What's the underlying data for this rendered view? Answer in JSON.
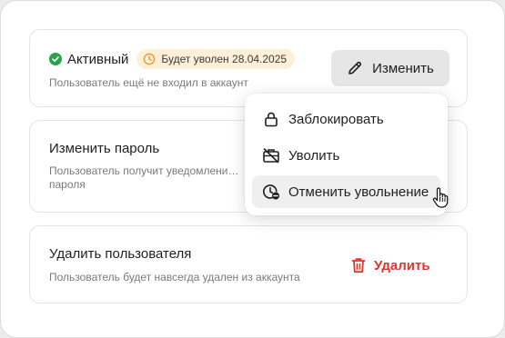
{
  "status": {
    "label": "Активный",
    "badge": "Будет уволен 28.04.2025",
    "subtitle": "Пользователь ещё не входил в аккаунт",
    "edit_button": "Изменить"
  },
  "password": {
    "title": "Изменить пароль",
    "description": "Пользователь получит уведомлени… пароля"
  },
  "delete": {
    "title": "Удалить пользователя",
    "description": "Пользователь будет навсегда удален из аккаунта",
    "button": "Удалить"
  },
  "menu": {
    "items": [
      {
        "label": "Заблокировать",
        "icon": "lock-icon"
      },
      {
        "label": "Уволить",
        "icon": "briefcase-off-icon"
      },
      {
        "label": "Отменить увольнение",
        "icon": "clock-cancel-icon"
      }
    ]
  },
  "colors": {
    "accent_green": "#2aa34a",
    "badge_bg": "#fdf0d9",
    "badge_icon": "#e8a13a",
    "danger": "#e0352b",
    "button_bg": "#e6e6e6"
  }
}
